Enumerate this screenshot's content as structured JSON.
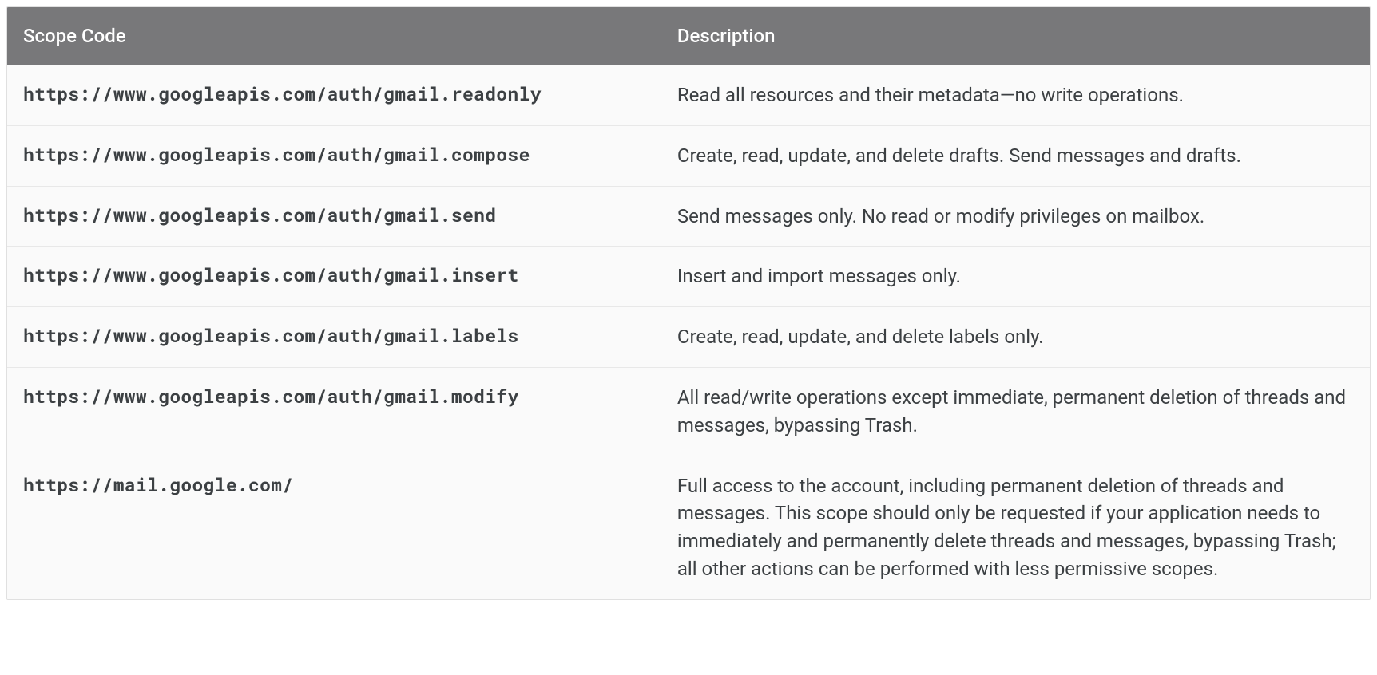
{
  "table": {
    "headers": {
      "scope": "Scope Code",
      "description": "Description"
    },
    "rows": [
      {
        "scope": "https://www.googleapis.com/auth/gmail.readonly",
        "description": "Read all resources and their metadata—no write operations."
      },
      {
        "scope": "https://www.googleapis.com/auth/gmail.compose",
        "description": "Create, read, update, and delete drafts. Send messages and drafts."
      },
      {
        "scope": "https://www.googleapis.com/auth/gmail.send",
        "description": "Send messages only. No read or modify privileges on mailbox."
      },
      {
        "scope": "https://www.googleapis.com/auth/gmail.insert",
        "description": "Insert and import messages only."
      },
      {
        "scope": "https://www.googleapis.com/auth/gmail.labels",
        "description": "Create, read, update, and delete labels only."
      },
      {
        "scope": "https://www.googleapis.com/auth/gmail.modify",
        "description": "All read/write operations except immediate, permanent deletion of threads and messages, bypassing Trash."
      },
      {
        "scope": "https://mail.google.com/",
        "description": "Full access to the account, including permanent deletion of threads and messages. This scope should only be requested if your application needs to immediately and permanently delete threads and messages, bypassing Trash; all other actions can be performed with less permissive scopes."
      }
    ]
  }
}
